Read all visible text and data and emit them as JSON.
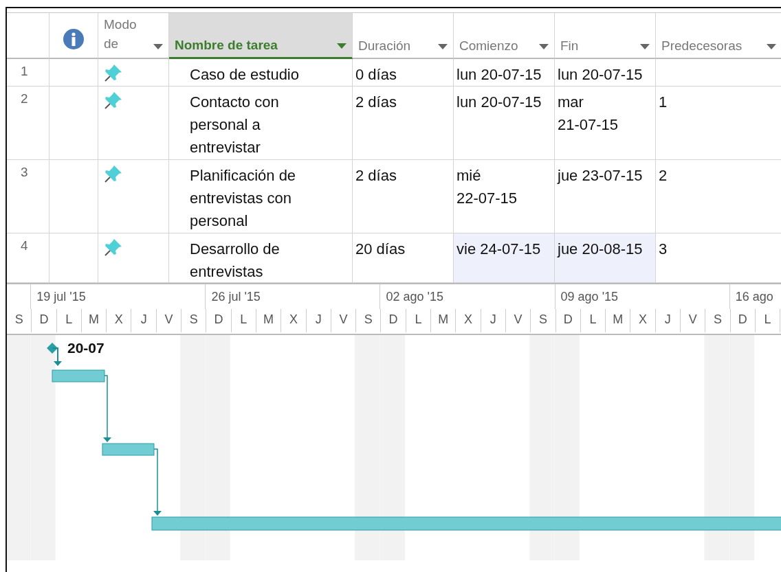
{
  "columns": [
    {
      "kind": "rownum"
    },
    {
      "kind": "info"
    },
    {
      "kind": "mode",
      "label": "Modo de"
    },
    {
      "kind": "text",
      "label": "Nombre de tarea",
      "selected": true
    },
    {
      "kind": "text",
      "label": "Duración",
      "selected": false
    },
    {
      "kind": "text",
      "label": "Comienzo",
      "selected": false
    },
    {
      "kind": "text",
      "label": "Fin",
      "selected": false
    },
    {
      "kind": "text",
      "label": "Predecesoras",
      "selected": false
    }
  ],
  "rows": [
    {
      "id": "1",
      "name": "Caso de estudio",
      "duration": "0 días",
      "start": "lun 20-07-15",
      "finish": "lun 20-07-15",
      "selected": false
    },
    {
      "id": "2",
      "name": "Contacto con\npersonal a\nentrevistar",
      "duration": "2 días",
      "start": "lun 20-07-15",
      "finish": "mar\n21-07-15",
      "predecessors": "1",
      "selected": false
    },
    {
      "id": "3",
      "name": "Planificación de\nentrevistas con\npersonal",
      "duration": "2 días",
      "start": "mié\n22-07-15",
      "finish": "jue 23-07-15",
      "predecessors": "2",
      "selected": false
    },
    {
      "id": "4",
      "name": "Desarrollo de\nentrevistas",
      "duration": "20 días",
      "start": "vie 24-07-15",
      "finish": "jue 20-08-15",
      "predecessors": "3",
      "selected": true
    }
  ],
  "timeline": {
    "weeks": [
      "19 jul '15",
      "26 jul '15",
      "02 ago '15",
      "09 ago '15",
      "16 ago"
    ],
    "days": [
      "S",
      "D",
      "L",
      "M",
      "X",
      "J",
      "V",
      "S",
      "D",
      "L",
      "M",
      "X",
      "J",
      "V",
      "S",
      "D",
      "L",
      "M",
      "X",
      "J",
      "V",
      "S",
      "D",
      "L",
      "M",
      "X",
      "J",
      "V",
      "S",
      "D",
      "L"
    ]
  },
  "gantt": {
    "milestone_label": "20-07"
  }
}
